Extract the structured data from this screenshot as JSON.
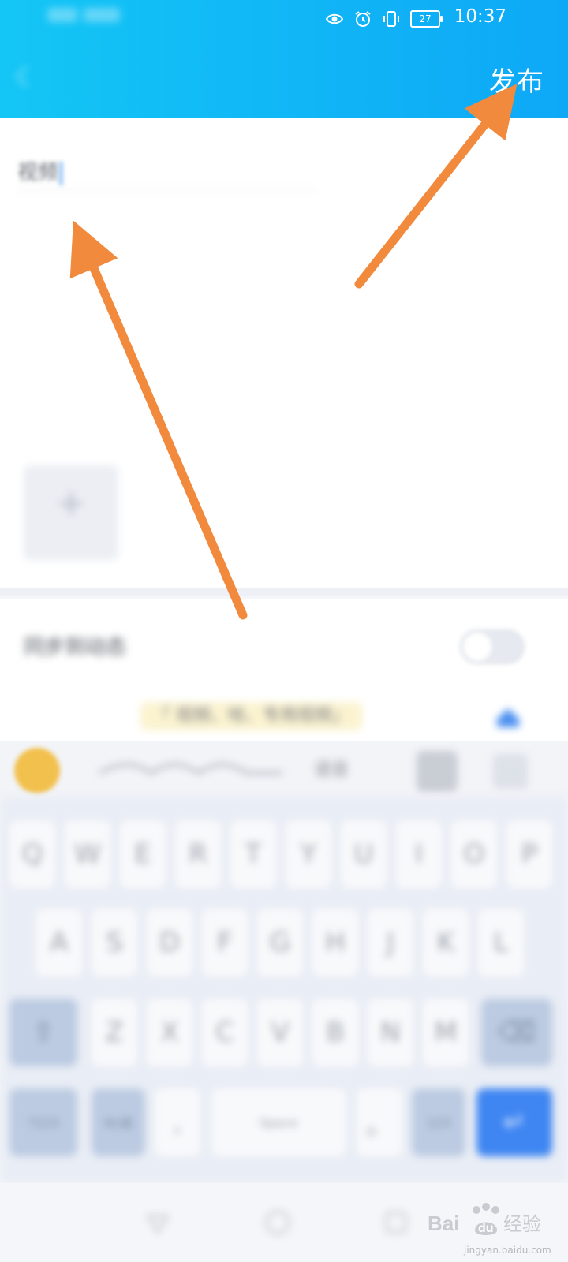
{
  "status_bar": {
    "battery": "27",
    "time": "10:37"
  },
  "header": {
    "publish_label": "发布"
  },
  "editor": {
    "title_text": "视频",
    "add_image_icon": "plus-icon"
  },
  "options": {
    "toggle_label": "同步到动态",
    "toggle_on": false
  },
  "suggestions": {
    "chip_text": "「 视频、哈、专用视频」"
  },
  "toolbar": {
    "mic_label": "语音"
  },
  "keyboard": {
    "row1": [
      "Q",
      "W",
      "E",
      "R",
      "T",
      "Y",
      "U",
      "I",
      "O",
      "P"
    ],
    "row2": [
      "A",
      "S",
      "D",
      "F",
      "G",
      "H",
      "J",
      "K",
      "L"
    ],
    "row3": [
      "Z",
      "X",
      "C",
      "V",
      "B",
      "N",
      "M"
    ],
    "space_label": "Space",
    "comma": ",",
    "period": "。"
  },
  "colors": {
    "header_accent": "#10b4f6",
    "arrow": "#f28a3e",
    "enter_key": "#3f86f2"
  },
  "watermark": {
    "brand": "Baidu 经验",
    "caption": "jingyan.baidu.com"
  }
}
